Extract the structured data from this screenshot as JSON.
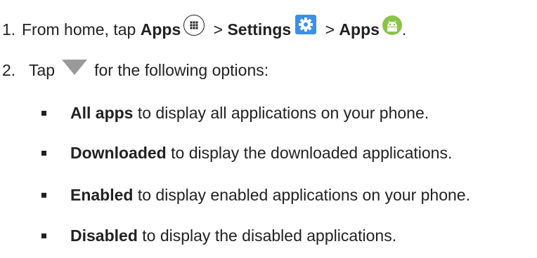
{
  "steps": [
    {
      "number": "1.",
      "text_from_home": "From home, tap ",
      "apps_label": "Apps",
      "sep1": " > ",
      "settings_label": "Settings",
      "sep2": " > ",
      "apps_label_2": "Apps",
      "end": "."
    },
    {
      "number": "2.",
      "tap": "Tap",
      "rest": "for the following options:"
    }
  ],
  "options": [
    {
      "bold": "All apps",
      "text": " to display all applications on your phone."
    },
    {
      "bold": "Downloaded",
      "text": " to display the downloaded applications."
    },
    {
      "bold": "Enabled",
      "text": " to display enabled applications on your phone."
    },
    {
      "bold": "Disabled",
      "text": " to display the disabled applications."
    }
  ],
  "icons": {
    "apps": "apps-grid-icon",
    "settings": "settings-gear-icon",
    "android_apps": "android-apps-icon",
    "dropdown": "dropdown-triangle-icon"
  },
  "colors": {
    "settings_blue": "#3a8fe8",
    "android_green": "#8bc34a",
    "triangle_gray": "#9a9a9a"
  }
}
